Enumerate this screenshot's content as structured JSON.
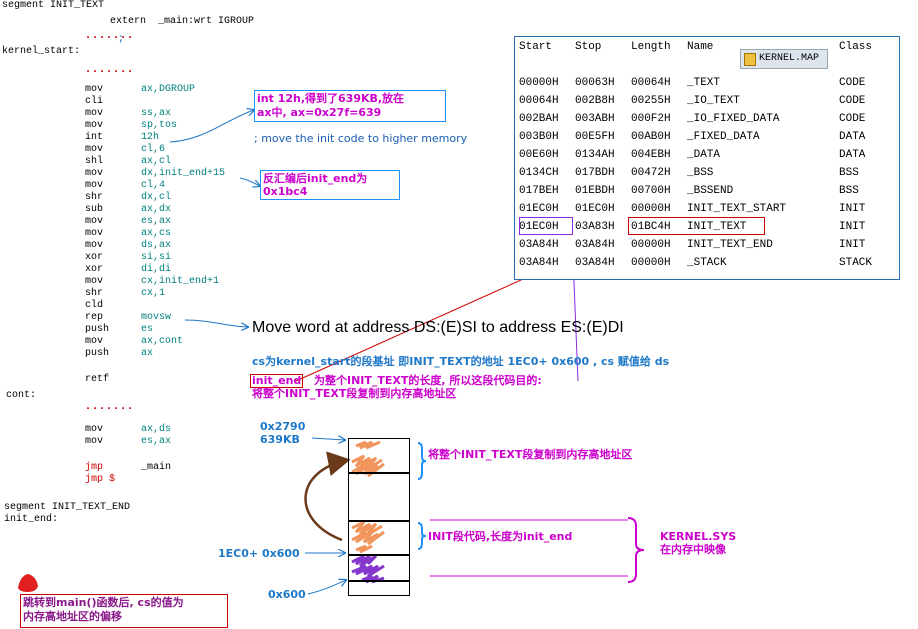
{
  "listing": {
    "seg_header": "segment INIT_TEXT",
    "extern_line": "extern  _main:wrt IGROUP",
    "semicolon": ";",
    "kernel_start": "kernel_start:",
    "dots": ".......",
    "instructions": [
      {
        "op": "mov",
        "arg": "ax,DGROUP"
      },
      {
        "op": "cli",
        "arg": ""
      },
      {
        "op": "mov",
        "arg": "ss,ax"
      },
      {
        "op": "mov",
        "arg": "sp,tos"
      },
      {
        "op": "int",
        "arg": "12h"
      },
      {
        "op": "mov",
        "arg": "cl,6"
      },
      {
        "op": "shl",
        "arg": "ax,cl"
      },
      {
        "op": "mov",
        "arg": "dx,init_end+15"
      },
      {
        "op": "mov",
        "arg": "cl,4"
      },
      {
        "op": "shr",
        "arg": "dx,cl"
      },
      {
        "op": "sub",
        "arg": "ax,dx"
      },
      {
        "op": "mov",
        "arg": "es,ax"
      },
      {
        "op": "mov",
        "arg": "ax,cs"
      },
      {
        "op": "mov",
        "arg": "ds,ax"
      },
      {
        "op": "xor",
        "arg": "si,si"
      },
      {
        "op": "xor",
        "arg": "di,di"
      },
      {
        "op": "mov",
        "arg": "cx,init_end+1"
      },
      {
        "op": "shr",
        "arg": "cx,1"
      },
      {
        "op": "cld",
        "arg": ""
      },
      {
        "op": "rep",
        "arg": "movsw"
      },
      {
        "op": "push",
        "arg": "es"
      },
      {
        "op": "mov",
        "arg": "ax,cont"
      },
      {
        "op": "push",
        "arg": "ax"
      }
    ],
    "retf": "retf",
    "cont_label": "cont:",
    "cont_instructions": [
      {
        "op": "mov",
        "arg": "ax,ds"
      },
      {
        "op": "mov",
        "arg": "es,ax"
      }
    ],
    "jmp1_op": "jmp",
    "jmp1_arg": "_main",
    "jmp2": "jmp $",
    "seg_end": "segment INIT_TEXT_END",
    "init_end": "init_end:"
  },
  "notes": {
    "int12_line1": "int 12h,得到了639KB,放在",
    "int12_line2": "ax中, ax=0x27f=639",
    "move_init": "; move the init code to higher memory",
    "disasm_line1": "反汇编后init_end为",
    "disasm_line2": "0x1bc4",
    "movsw": "Move word at address DS:(E)SI to address ES:(E)DI",
    "cs_note": "cs为kernel_start的段基址 即INIT_TEXT的地址 1EC0+ 0x600 , cs 赋值给 ds",
    "init_end_word": "init_end",
    "init_end_note": "为整个INIT_TEXT的长度, 所以这段代码目的:",
    "copy_note": "将整个INIT_TEXT段复制到内存高地址区",
    "mem_top1": "0x2790",
    "mem_top2": "639KB",
    "brace_top": "将整个INIT_TEXT段复制到内存高地址区",
    "brace_mid": "INIT段代码,长度为init_end",
    "kernel_sys1": "KERNEL.SYS",
    "kernel_sys2": "在内存中映像",
    "addr_1ec0": "1EC0+ 0x600",
    "addr_600": "0x600",
    "jump_note1": "跳转到main()函数后, cs的值为",
    "jump_note2": "内存高地址区的偏移"
  },
  "map": {
    "badge": "KERNEL.MAP",
    "headers": [
      "Start",
      "Stop",
      "Length",
      "Name",
      "Class"
    ],
    "rows": [
      [
        "00000H",
        "00063H",
        "00064H",
        "_TEXT",
        "CODE"
      ],
      [
        "00064H",
        "002B8H",
        "00255H",
        "_IO_TEXT",
        "CODE"
      ],
      [
        "002BAH",
        "003ABH",
        "000F2H",
        "_IO_FIXED_DATA",
        "CODE"
      ],
      [
        "003B0H",
        "00E5FH",
        "00AB0H",
        "_FIXED_DATA",
        "DATA"
      ],
      [
        "00E60H",
        "0134AH",
        "004EBH",
        "_DATA",
        "DATA"
      ],
      [
        "0134CH",
        "017BDH",
        "00472H",
        "_BSS",
        "BSS"
      ],
      [
        "017BEH",
        "01EBDH",
        "00700H",
        "_BSSEND",
        "BSS"
      ],
      [
        "01EC0H",
        "01EC0H",
        "00000H",
        "INIT_TEXT_START",
        "INIT"
      ],
      [
        "01EC0H",
        "03A83H",
        "01BC4H",
        "INIT_TEXT",
        "INIT"
      ],
      [
        "03A84H",
        "03A84H",
        "00000H",
        "INIT_TEXT_END",
        "INIT"
      ],
      [
        "03A84H",
        "03A84H",
        "00000H",
        "_STACK",
        "STACK"
      ]
    ]
  }
}
